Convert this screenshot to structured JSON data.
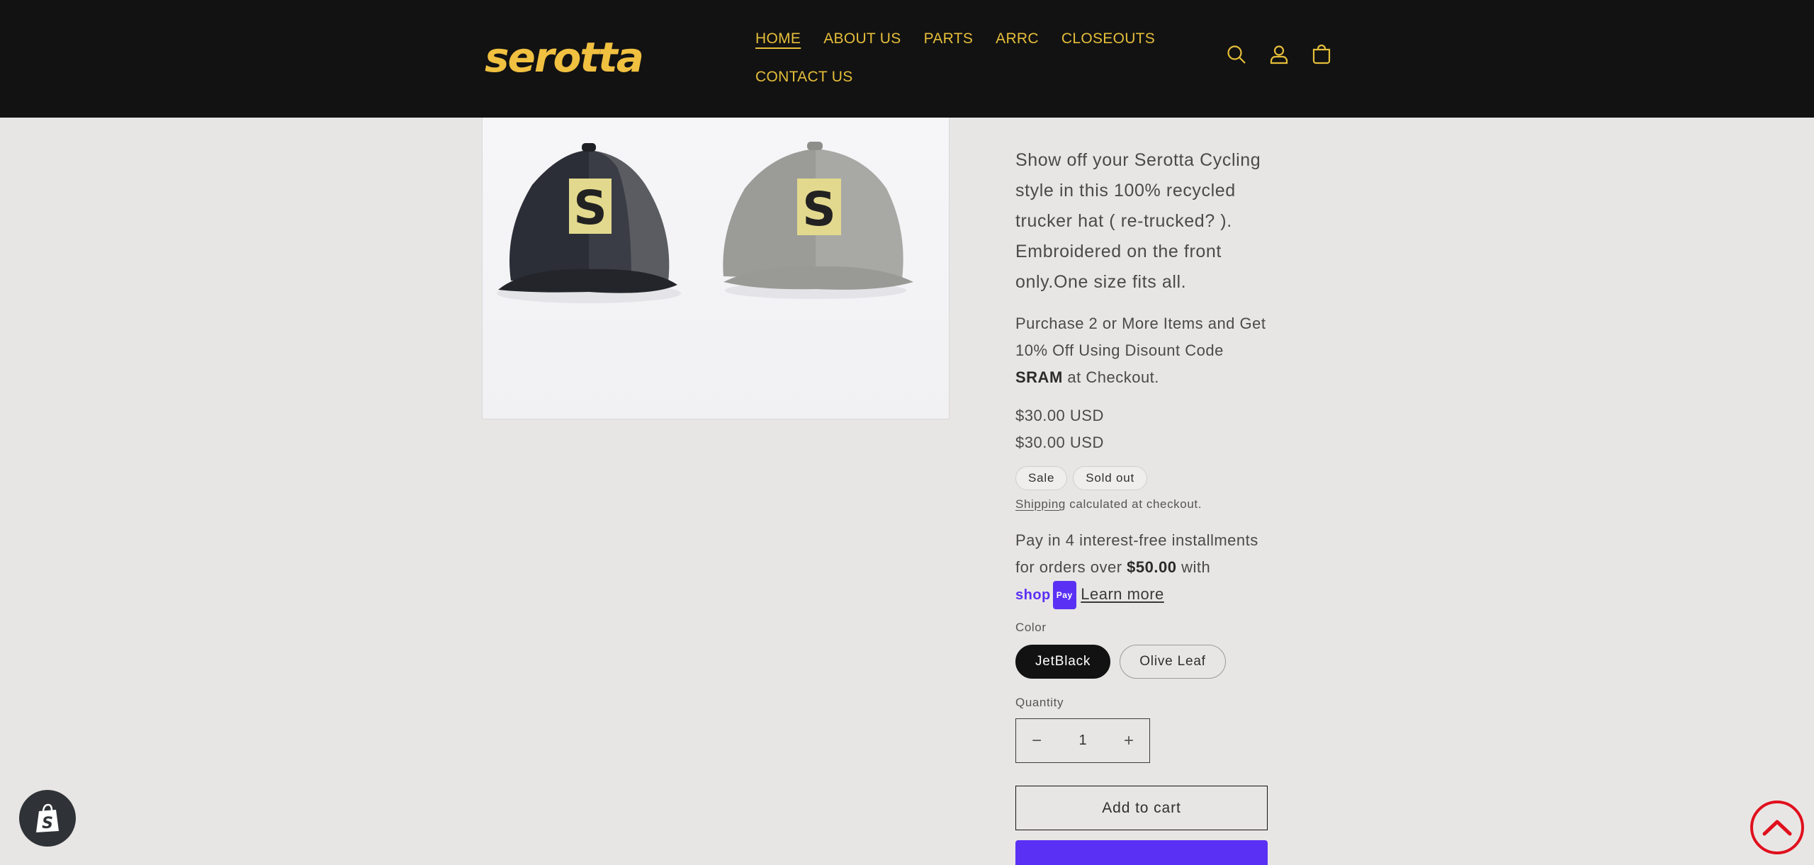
{
  "header": {
    "logo_text": "serotta",
    "nav": [
      {
        "label": "HOME",
        "active": true
      },
      {
        "label": "ABOUT US",
        "active": false
      },
      {
        "label": "PARTS",
        "active": false
      },
      {
        "label": "ARRC",
        "active": false
      },
      {
        "label": "CLOSEOUTS",
        "active": false
      },
      {
        "label": "CONTACT US",
        "active": false
      }
    ],
    "icons": [
      "search-icon",
      "account-icon",
      "cart-icon"
    ]
  },
  "product": {
    "image_icon": "trucker-hats-image",
    "description": "Show off your Serotta Cycling style in this 100% recycled trucker hat ( re-trucked? ). Embroidered on the front only.One size fits all.",
    "promo_before": "Purchase 2 or More Items and Get 10% Off Using Disount Code ",
    "promo_code": "SRAM",
    "promo_after": " at Checkout.",
    "regular_price": "$30.00 USD",
    "sale_price": "$30.00 USD",
    "badges": [
      "Sale",
      "Sold out"
    ],
    "shipping_link": "Shipping",
    "shipping_text": " calculated at checkout.",
    "installments_text": "Pay in 4 interest-free installments for orders over ",
    "installments_amount": "$50.00",
    "installments_with": " with ",
    "shoppay_label": "shop",
    "shoppay_pay": "Pay",
    "learn_more": "Learn more",
    "color_label": "Color",
    "colors": [
      {
        "label": "JetBlack",
        "selected": true
      },
      {
        "label": "Olive Leaf",
        "selected": false
      }
    ],
    "quantity_label": "Quantity",
    "quantity_value": "1",
    "minus": "−",
    "plus": "+",
    "add_to_cart": "Add to cart"
  },
  "colors": {
    "header_bg": "#121212",
    "accent": "#e5be3a",
    "shoppay": "#5a31f4",
    "scroll_top": "#e0101d"
  }
}
